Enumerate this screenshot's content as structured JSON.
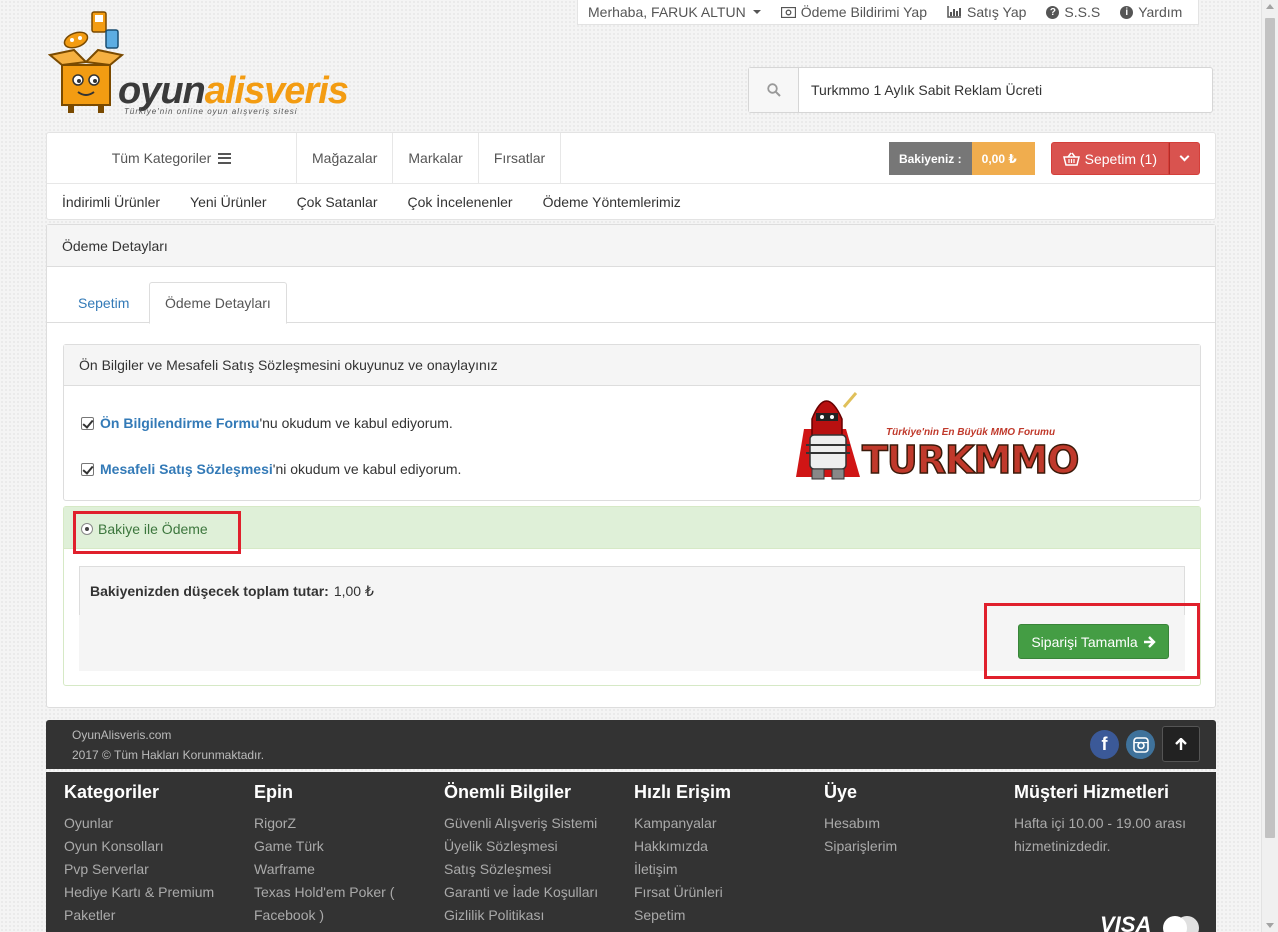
{
  "topbar": {
    "greeting": "Merhaba, FARUK ALTUN",
    "payment_notice": "Ödeme Bildirimi Yap",
    "sell": "Satış Yap",
    "faq": "S.S.S",
    "help": "Yardım"
  },
  "logo": {
    "text_a": "oyun",
    "text_b": "alisveris",
    "tagline": "Türkiye'nin online oyun alışveriş sitesi"
  },
  "search": {
    "value": "Turkmmo 1 Aylık Sabit Reklam Ücreti"
  },
  "nav": {
    "all_categories": "Tüm Kategoriler",
    "links": [
      "Mağazalar",
      "Markalar",
      "Fırsatlar"
    ],
    "balance_label": "Bakiyeniz :",
    "balance_value": "0,00 ₺",
    "cart": "Sepetim (1)",
    "sub_links": [
      "İndirimli Ürünler",
      "Yeni Ürünler",
      "Çok Satanlar",
      "Çok İncelenenler",
      "Ödeme Yöntemlerimiz"
    ]
  },
  "panel": {
    "title": "Ödeme Detayları",
    "tabs": [
      "Sepetim",
      "Ödeme Detayları"
    ],
    "agreements": {
      "title": "Ön Bilgiler ve Mesafeli Satış Sözleşmesini okuyunuz ve onaylayınız",
      "row1_link": "Ön Bilgilendirme Formu",
      "row1_text": "'nu okudum ve kabul ediyorum.",
      "row2_link": "Mesafeli Satış Sözleşmesi",
      "row2_text": "'ni okudum ve kabul ediyorum."
    },
    "turkmmo": {
      "tagline": "Türkiye'nin En Büyük MMO Forumu",
      "text": "TURKMMO"
    },
    "payment": {
      "option": "Bakiye ile Ödeme",
      "total_label": "Bakiyenizden düşecek toplam tutar:",
      "total_value": "1,00 ₺",
      "submit": "Siparişi Tamamla"
    }
  },
  "copyright": {
    "site": "OyunAlisveris.com",
    "rights": "2017 © Tüm Hakları Korunmaktadır."
  },
  "footer": {
    "columns": [
      {
        "title": "Kategoriler",
        "items": [
          "Oyunlar",
          "Oyun Konsolları",
          "Pvp Serverlar",
          "Hediye Kartı & Premium",
          "Paketler"
        ]
      },
      {
        "title": "Epin",
        "items": [
          "RigorZ",
          "Game Türk",
          "Warframe",
          "Texas Hold'em Poker (",
          "Facebook )"
        ]
      },
      {
        "title": "Önemli Bilgiler",
        "items": [
          "Güvenli Alışveriş Sistemi",
          "Üyelik Sözleşmesi",
          "Satış Sözleşmesi",
          "Garanti ve İade Koşulları",
          "Gizlilik Politikası"
        ]
      },
      {
        "title": "Hızlı Erişim",
        "items": [
          "Kampanyalar",
          "Hakkımızda",
          "İletişim",
          "Fırsat Ürünleri",
          "Sepetim"
        ]
      },
      {
        "title": "Üye",
        "items": [
          "Hesabım",
          "Siparişlerim"
        ]
      },
      {
        "title": "Müşteri Hizmetleri",
        "items": [
          "Hafta içi 10.00 - 19.00 arası",
          "hizmetinizdedir."
        ]
      }
    ],
    "visa": "VISA"
  }
}
